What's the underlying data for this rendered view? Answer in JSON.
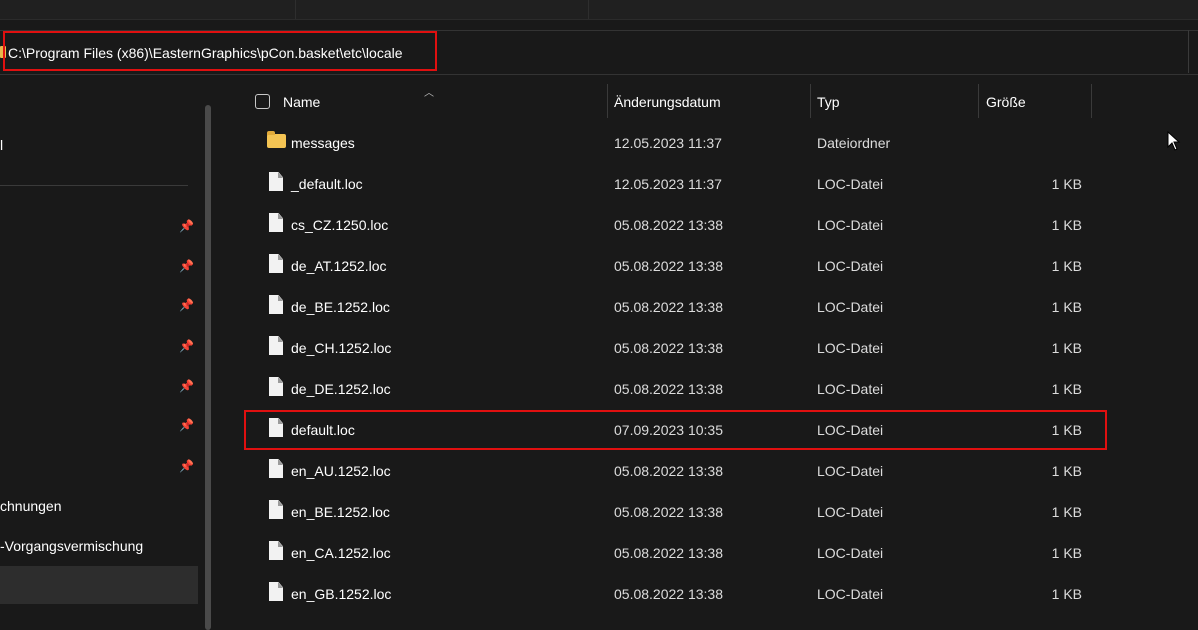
{
  "address": {
    "path": "C:\\Program Files (x86)\\EasternGraphics\\pCon.basket\\etc\\locale"
  },
  "sidebar": {
    "items": [
      {
        "label": "l"
      },
      {
        "label": "chnungen"
      },
      {
        "label": "-Vorgangsvermischung"
      }
    ],
    "pin_icon": "pin-icon"
  },
  "columns": {
    "name": "Name",
    "date": "Änderungsdatum",
    "type": "Typ",
    "size": "Größe"
  },
  "files": [
    {
      "icon": "folder-icon",
      "name": "messages",
      "date": "12.05.2023 11:37",
      "type": "Dateiordner",
      "size": ""
    },
    {
      "icon": "file-icon",
      "name": "_default.loc",
      "date": "12.05.2023 11:37",
      "type": "LOC-Datei",
      "size": "1 KB"
    },
    {
      "icon": "file-icon",
      "name": "cs_CZ.1250.loc",
      "date": "05.08.2022 13:38",
      "type": "LOC-Datei",
      "size": "1 KB"
    },
    {
      "icon": "file-icon",
      "name": "de_AT.1252.loc",
      "date": "05.08.2022 13:38",
      "type": "LOC-Datei",
      "size": "1 KB"
    },
    {
      "icon": "file-icon",
      "name": "de_BE.1252.loc",
      "date": "05.08.2022 13:38",
      "type": "LOC-Datei",
      "size": "1 KB"
    },
    {
      "icon": "file-icon",
      "name": "de_CH.1252.loc",
      "date": "05.08.2022 13:38",
      "type": "LOC-Datei",
      "size": "1 KB"
    },
    {
      "icon": "file-icon",
      "name": "de_DE.1252.loc",
      "date": "05.08.2022 13:38",
      "type": "LOC-Datei",
      "size": "1 KB"
    },
    {
      "icon": "file-icon",
      "name": "default.loc",
      "date": "07.09.2023 10:35",
      "type": "LOC-Datei",
      "size": "1 KB"
    },
    {
      "icon": "file-icon",
      "name": "en_AU.1252.loc",
      "date": "05.08.2022 13:38",
      "type": "LOC-Datei",
      "size": "1 KB"
    },
    {
      "icon": "file-icon",
      "name": "en_BE.1252.loc",
      "date": "05.08.2022 13:38",
      "type": "LOC-Datei",
      "size": "1 KB"
    },
    {
      "icon": "file-icon",
      "name": "en_CA.1252.loc",
      "date": "05.08.2022 13:38",
      "type": "LOC-Datei",
      "size": "1 KB"
    },
    {
      "icon": "file-icon",
      "name": "en_GB.1252.loc",
      "date": "05.08.2022 13:38",
      "type": "LOC-Datei",
      "size": "1 KB"
    }
  ],
  "colors": {
    "background": "#191919",
    "highlight": "#e01010",
    "folder": "#f4c453"
  }
}
